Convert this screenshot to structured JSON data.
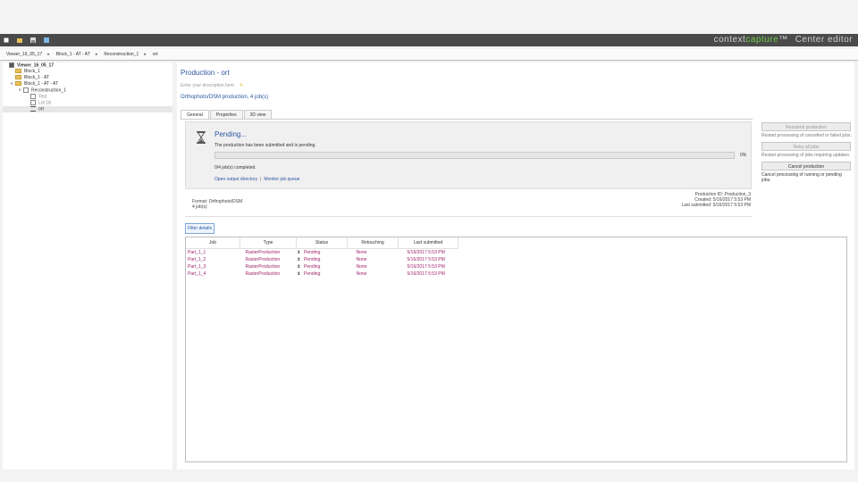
{
  "app": {
    "brand_prefix": "context",
    "brand_highlight": "capture",
    "brand_tm": "™",
    "brand_suffix": "Center editor"
  },
  "breadcrumb": [
    "Viewer_16_05_17",
    "Block_1 - AT - AT",
    "Reconstruction_1",
    "ort"
  ],
  "tree": [
    {
      "label": "Viewer_16_05_17",
      "level": 0,
      "icon": "project-icon",
      "toggle": "",
      "bold": true
    },
    {
      "label": "Block_1",
      "level": 1,
      "icon": "folder-icon",
      "toggle": ""
    },
    {
      "label": "Block_1 - AT",
      "level": 1,
      "icon": "folder-icon",
      "toggle": ""
    },
    {
      "label": "Block_1 - AT - AT",
      "level": 1,
      "icon": "folder-icon",
      "toggle": "v"
    },
    {
      "label": "Reconstruction_1",
      "level": 2,
      "icon": "reconstruction-icon",
      "toggle": "v"
    },
    {
      "label": "Test",
      "level": 3,
      "icon": "tile-icon",
      "toggle": ""
    },
    {
      "label": "Lot 18",
      "level": 3,
      "icon": "production-icon",
      "toggle": ""
    },
    {
      "label": "ort",
      "level": 3,
      "icon": "hourglass-icon",
      "toggle": "",
      "selected": true
    }
  ],
  "production": {
    "title": "Production - ort",
    "description_placeholder": "Enter your description here",
    "subtitle": "Orthophoto/DSM production, 4 job(s)",
    "tabs": [
      "General",
      "Properties",
      "3D view"
    ],
    "active_tab": 0
  },
  "status": {
    "title": "Pending...",
    "message": "The production has been submitted and is pending.",
    "progress": 0,
    "progress_label": "0%",
    "jobs_completed": "0/4 job(s) completed.",
    "link_output": "Open output directory",
    "link_sep": "|",
    "link_monitor": "Monitor job queue"
  },
  "info": {
    "format": "Format: Orthophoto/DSM",
    "jobs": "4 job(s)",
    "production_id": "Production ID: Production_3",
    "created": "Created: 5/16/2017 5:53 PM",
    "last_submitted": "Last submitted: 5/16/2017 5:53 PM"
  },
  "actions": [
    {
      "label": "Resubmit production",
      "desc": "Restart processing of cancelled or failed jobs.",
      "disabled": true
    },
    {
      "label": "Retry all jobs",
      "desc": "Restart processing of jobs requiring updates.",
      "disabled": true
    },
    {
      "label": "Cancel production",
      "desc": "Cancel processing of running or pending jobs.",
      "disabled": false
    }
  ],
  "filter_button": "Filter details",
  "table": {
    "columns": [
      "Job",
      "Type",
      "Status",
      "Retouching",
      "Last submitted"
    ],
    "rows": [
      [
        "Part_1_1",
        "RasterProduction",
        "Pending",
        "None",
        "5/16/2017 5:53 PM"
      ],
      [
        "Part_1_2",
        "RasterProduction",
        "Pending",
        "None",
        "5/16/2017 5:53 PM"
      ],
      [
        "Part_1_3",
        "RasterProduction",
        "Pending",
        "None",
        "5/16/2017 5:53 PM"
      ],
      [
        "Part_1_4",
        "RasterProduction",
        "Pending",
        "None",
        "5/16/2017 5:53 PM"
      ]
    ]
  },
  "colors": {
    "titlebar": "#4a4a4a",
    "accent": "#2d57a3",
    "brand_green": "#6fcf4a",
    "row_text": "#a0226b"
  }
}
